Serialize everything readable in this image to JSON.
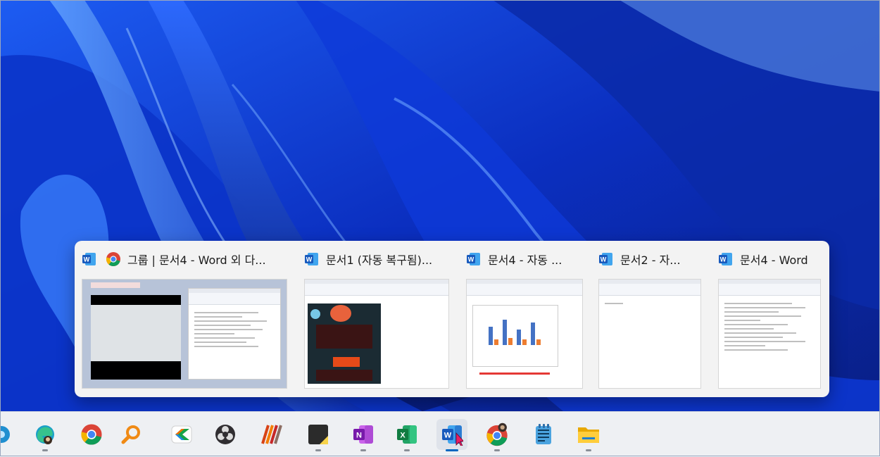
{
  "preview_cards": [
    {
      "title": "그룹 | 문서4 - Word 외 다...",
      "icons": [
        "word-icon",
        "chrome-icon"
      ]
    },
    {
      "title": "문서1 (자동 복구됨)...",
      "icons": [
        "word-icon"
      ]
    },
    {
      "title": "문서4  -  자동 ...",
      "icons": [
        "word-icon"
      ]
    },
    {
      "title": "문서2  -  자...",
      "icons": [
        "word-icon"
      ]
    },
    {
      "title": "문서4 - Word",
      "icons": [
        "word-icon"
      ]
    }
  ],
  "taskbar": {
    "items": [
      "widgets-icon",
      "edge-icon",
      "chrome-icon",
      "search-app-icon",
      "pen-app-icon",
      "obs-icon",
      "stripes-app-icon",
      "sticky-notes-icon",
      "onenote-icon",
      "excel-icon",
      "word-icon",
      "chrome-profile-icon",
      "notepad-icon",
      "file-explorer-icon"
    ],
    "active": "word-icon"
  },
  "colors": {
    "wallpaper": "#0a2fb8",
    "word": "#185abd",
    "excel": "#107c41",
    "onenote": "#7719aa",
    "accent": "#0067c0"
  }
}
